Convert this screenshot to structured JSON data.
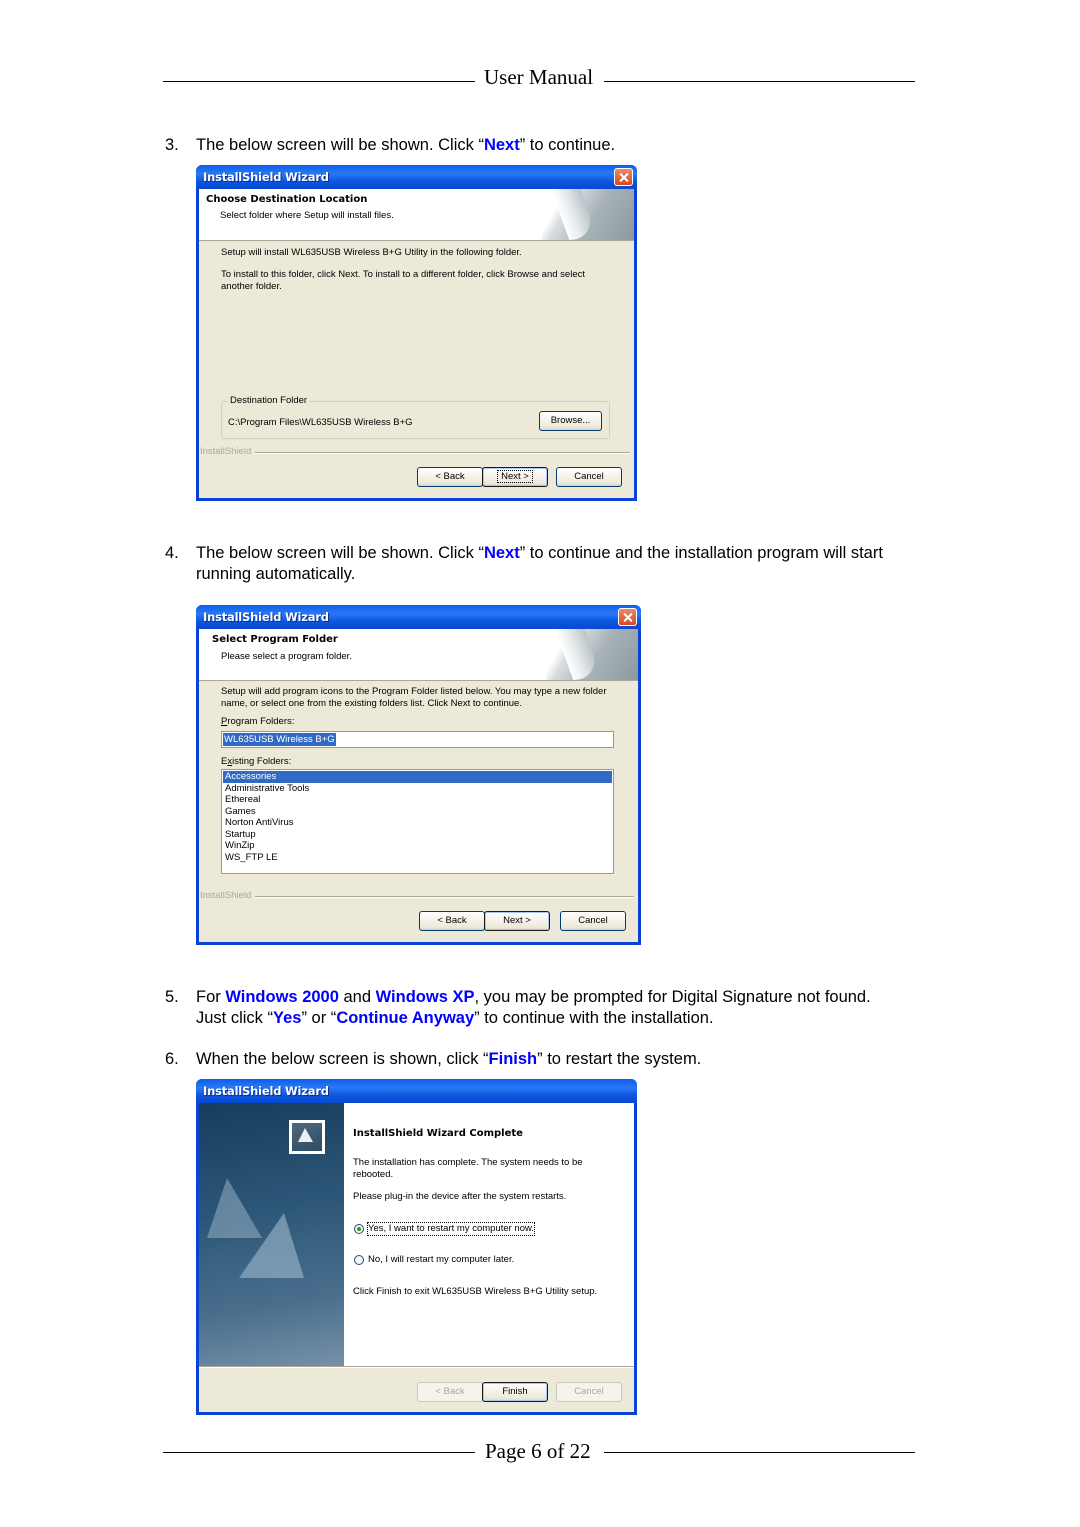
{
  "page_header": {
    "title": "User Manual"
  },
  "page_footer": {
    "text": "Page 6 of 22"
  },
  "colors": {
    "highlight": "#0000ff",
    "xp_titlebar": "#0a5fea",
    "dialog_bg": "#ece9d8",
    "selection": "#316ac5"
  },
  "steps": [
    {
      "number": "3.",
      "segments": [
        {
          "text": "The below screen will be shown. Click “"
        },
        {
          "text": "Next",
          "highlight": true
        },
        {
          "text": "” to continue."
        }
      ]
    },
    {
      "number": "4.",
      "segments": [
        {
          "text": "The below screen will be shown. Click “"
        },
        {
          "text": "Next",
          "highlight": true
        },
        {
          "text": "” to continue and the installation program will start running automatically."
        }
      ]
    },
    {
      "number": "5.",
      "segments": [
        {
          "text": "For "
        },
        {
          "text": "Windows 2000",
          "highlight": true
        },
        {
          "text": " and "
        },
        {
          "text": "Windows XP",
          "highlight": true
        },
        {
          "text": ", you may be prompted for Digital Signature not found. Just click “"
        },
        {
          "text": "Yes",
          "highlight": true
        },
        {
          "text": "” or “"
        },
        {
          "text": "Continue Anyway",
          "highlight": true
        },
        {
          "text": "” to continue with the installation."
        }
      ]
    },
    {
      "number": "6.",
      "segments": [
        {
          "text": "When the below screen is shown, click “"
        },
        {
          "text": "Finish",
          "highlight": true
        },
        {
          "text": "” to restart the system."
        }
      ]
    }
  ],
  "dialog1": {
    "title": "InstallShield Wizard",
    "header_title": "Choose Destination Location",
    "header_subtitle": "Select folder where Setup will install files.",
    "line1": "Setup will install WL635USB Wireless B+G Utility in the following folder.",
    "line2": "To install to this folder, click Next. To install to a different folder, click Browse and select another folder.",
    "group_label": "Destination Folder",
    "path": "C:\\Program Files\\WL635USB Wireless B+G",
    "browse_label": "Browse...",
    "brand": "InstallShield",
    "back_label": "< Back",
    "next_label": "Next >",
    "cancel_label": "Cancel"
  },
  "dialog2": {
    "title": "InstallShield Wizard",
    "header_title": "Select Program Folder",
    "header_subtitle": "Please select a program folder.",
    "description": "Setup will add program icons to the Program Folder listed below.  You may type a new folder name, or select one from the existing folders list.  Click Next to continue.",
    "program_folders_label": "Program Folders:",
    "program_folder_value": "WL635USB Wireless B+G",
    "existing_folders_label": "Existing Folders:",
    "existing_folders": [
      "Accessories",
      "Administrative Tools",
      "Ethereal",
      "Games",
      "Norton AntiVirus",
      "Startup",
      "WinZip",
      "WS_FTP LE"
    ],
    "selected_folder": "Accessories",
    "brand": "InstallShield",
    "back_label": "< Back",
    "next_label": "Next >",
    "cancel_label": "Cancel"
  },
  "dialog3": {
    "title": "InstallShield Wizard",
    "heading": "InstallShield Wizard Complete",
    "text1": "The installation has complete. The system needs to be rebooted.",
    "text2": "Please plug-in the device after the system restarts.",
    "option_yes": "Yes, I want to restart my computer now.",
    "option_no": "No, I will restart my computer later.",
    "selected_option": "yes",
    "footer_text": "Click Finish to exit WL635USB Wireless B+G Utility setup.",
    "back_label": "< Back",
    "finish_label": "Finish",
    "cancel_label": "Cancel"
  }
}
